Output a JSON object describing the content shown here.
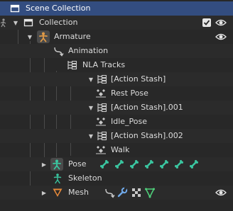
{
  "outliner": {
    "header": {
      "label": "Scene Collection"
    },
    "rows": {
      "collection": "Collection",
      "armature": "Armature",
      "animation": "Animation",
      "nla_tracks": "NLA Tracks",
      "stash1": "[Action Stash]",
      "rest_pose": "Rest Pose",
      "stash2": "[Action Stash].001",
      "idle_pose": "Idle_Pose",
      "stash3": "[Action Stash].002",
      "walk": "Walk",
      "pose": "Pose",
      "skeleton": "Skeleton",
      "mesh": "Mesh"
    },
    "pose_bone_count": 7,
    "colors": {
      "header_bg": "#334d80",
      "bone_teal": "#3ac6a0",
      "armature_orange": "#e09a47",
      "mesh_orange": "#e6893a",
      "modifier_blue": "#6fa8e8",
      "material_green": "#4fcf7a"
    },
    "icons": {
      "collection": "collection-box-icon",
      "armature": "armature-object-icon",
      "animation": "animation-data-icon",
      "nla": "nla-tracks-icon",
      "action": "action-icon",
      "pose": "pose-icon",
      "skeleton": "skeleton-icon",
      "mesh": "mesh-object-icon",
      "visibility": "eye-icon",
      "checkbox": "checkbox-icon"
    }
  }
}
